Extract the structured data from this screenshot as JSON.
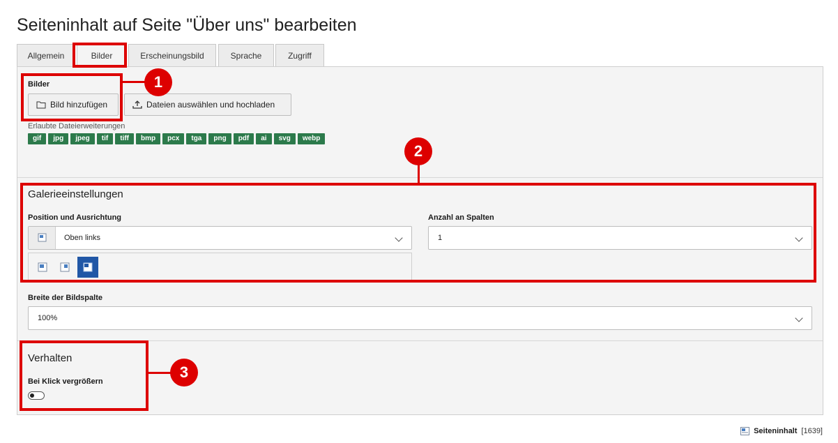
{
  "page": {
    "title": "Seiteninhalt auf Seite \"Über uns\" bearbeiten"
  },
  "tabs": [
    {
      "label": "Allgemein"
    },
    {
      "label": "Bilder"
    },
    {
      "label": "Erscheinungsbild"
    },
    {
      "label": "Sprache"
    },
    {
      "label": "Zugriff"
    }
  ],
  "images": {
    "label": "Bilder",
    "add_button": "Bild hinzufügen",
    "upload_button": "Dateien auswählen und hochladen",
    "allowed_label": "Erlaubte Dateierweiterungen",
    "extensions": [
      "gif",
      "jpg",
      "jpeg",
      "tif",
      "tiff",
      "bmp",
      "pcx",
      "tga",
      "png",
      "pdf",
      "ai",
      "svg",
      "webp"
    ]
  },
  "gallery": {
    "title": "Galerieeinstellungen",
    "position_label": "Position und Ausrichtung",
    "position_value": "Oben links",
    "columns_label": "Anzahl an Spalten",
    "columns_value": "1"
  },
  "width": {
    "label": "Breite der Bildspalte",
    "value": "100%"
  },
  "behavior": {
    "title": "Verhalten",
    "zoom_label": "Bei Klick vergrößern",
    "zoom_enabled": false
  },
  "markers": [
    "1",
    "2",
    "3"
  ],
  "footer": {
    "record_type": "Seiteninhalt",
    "record_id": "[1639]"
  },
  "colors": {
    "badge": "#2c7a4b",
    "highlight": "#dd0000",
    "active_icon": "#2157a6"
  }
}
